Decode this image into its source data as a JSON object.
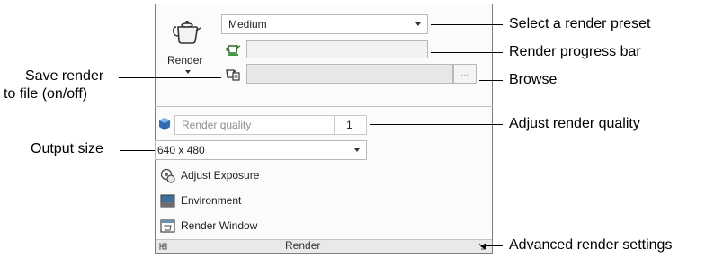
{
  "panel": {
    "render_button_label": "Render",
    "preset_value": "Medium",
    "render_quality_placeholder": "Render quality",
    "render_quality_value": "1",
    "browse_label": "...",
    "output_size_value": "640 x 480",
    "commands": [
      {
        "label": "Adjust Exposure",
        "icon": "exposure-icon"
      },
      {
        "label": "Environment",
        "icon": "environment-icon"
      },
      {
        "label": "Render Window",
        "icon": "render-window-icon"
      }
    ],
    "footer_title": "Render"
  },
  "callouts": {
    "select_preset": "Select a render preset",
    "progress_bar": "Render progress bar",
    "save_render_line1": "Save render",
    "save_render_line2": "to file (on/off)",
    "browse": "Browse",
    "adjust_quality": "Adjust render quality",
    "output_size": "Output size",
    "advanced_settings": "Advanced render settings"
  }
}
